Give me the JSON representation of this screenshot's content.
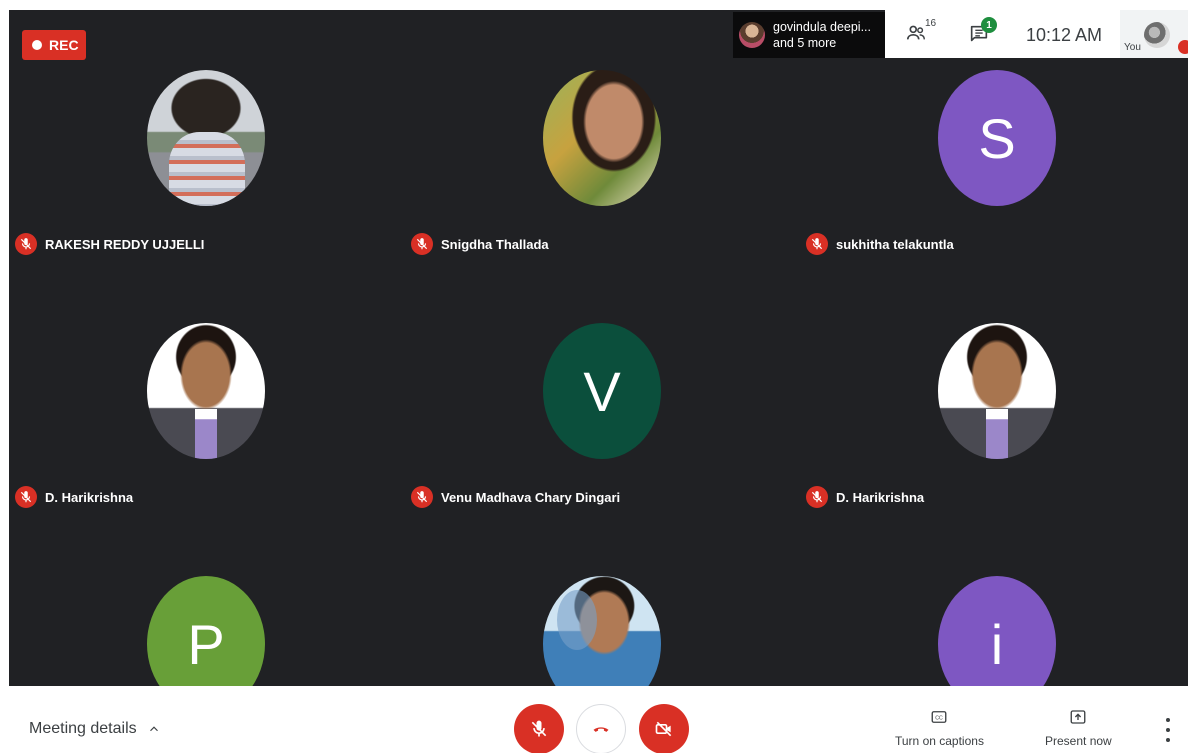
{
  "recording": {
    "label": "REC"
  },
  "presenter_chip": {
    "line1": "govindula deepi...",
    "line2": "and 5 more"
  },
  "topbar": {
    "people_count": "16",
    "chat_badge": "1",
    "time": "10:12 AM",
    "you_label": "You"
  },
  "participants": [
    {
      "name": "RAKESH REDDY UJJELLI",
      "avatar_type": "photo",
      "avatar_letter": ""
    },
    {
      "name": "Snigdha Thallada",
      "avatar_type": "photo",
      "avatar_letter": ""
    },
    {
      "name": "sukhitha telakuntla",
      "avatar_type": "letter",
      "avatar_letter": "S",
      "avatar_color": "#7e57c2"
    },
    {
      "name": "D. Harikrishna",
      "avatar_type": "photo",
      "avatar_letter": ""
    },
    {
      "name": "Venu Madhava Chary Dingari",
      "avatar_type": "letter",
      "avatar_letter": "V",
      "avatar_color": "#0b4f3c"
    },
    {
      "name": "D. Harikrishna",
      "avatar_type": "photo",
      "avatar_letter": ""
    },
    {
      "name": "",
      "avatar_type": "letter",
      "avatar_letter": "P",
      "avatar_color": "#689f38"
    },
    {
      "name": "",
      "avatar_type": "photo",
      "avatar_letter": ""
    },
    {
      "name": "",
      "avatar_type": "letter",
      "avatar_letter": "i",
      "avatar_color": "#7e57c2"
    }
  ],
  "bottombar": {
    "meeting_details_label": "Meeting details",
    "captions_label": "Turn on captions",
    "present_label": "Present now"
  },
  "colors": {
    "stage_bg": "#202124",
    "danger_red": "#d93025",
    "chat_badge_green": "#1e8e3e"
  },
  "icons": {
    "rec": "record-dot-icon",
    "people": "people-icon",
    "chat": "chat-icon",
    "mic_off": "mic-off-icon",
    "hang_up": "phone-hangup-icon",
    "camera_off": "camera-off-icon",
    "captions": "closed-captions-icon",
    "present": "present-screen-icon",
    "more": "more-vertical-icon",
    "chevron": "chevron-up-icon"
  }
}
